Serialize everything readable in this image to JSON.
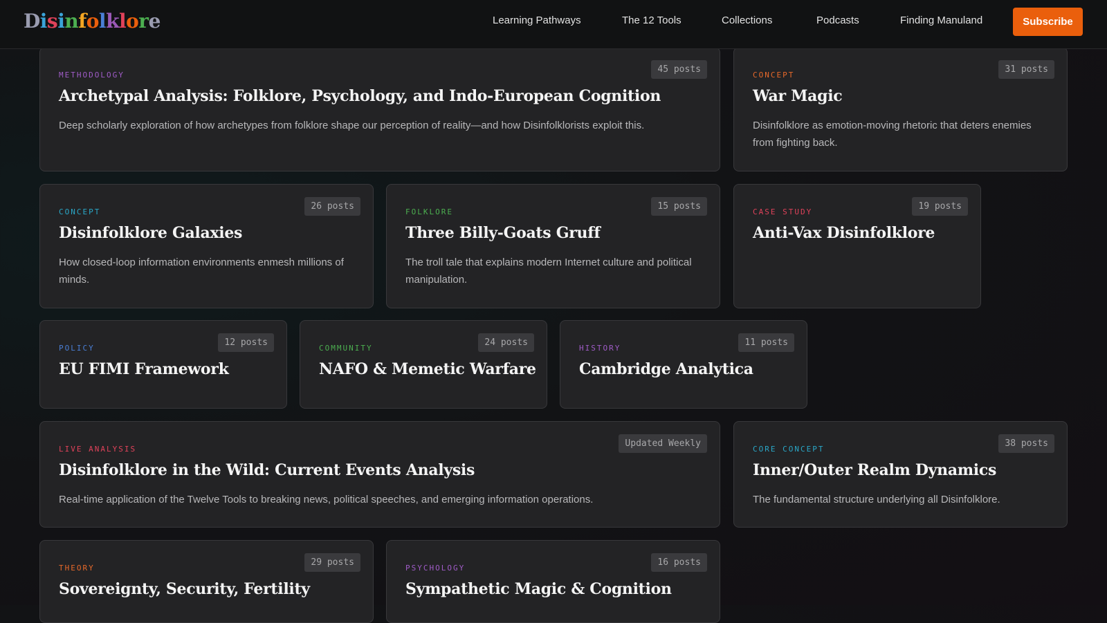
{
  "header": {
    "logo_letters": [
      {
        "ch": "D",
        "color": "#9a9cb0"
      },
      {
        "ch": "i",
        "color": "#3aa3d8"
      },
      {
        "ch": "s",
        "color": "#e0425a"
      },
      {
        "ch": "i",
        "color": "#3aa3d8"
      },
      {
        "ch": "n",
        "color": "#4caf50"
      },
      {
        "ch": "f",
        "color": "#f5a623"
      },
      {
        "ch": "o",
        "color": "#ea5f0c"
      },
      {
        "ch": "l",
        "color": "#4a7fd6"
      },
      {
        "ch": "k",
        "color": "#9b59b6"
      },
      {
        "ch": "l",
        "color": "#e0425a"
      },
      {
        "ch": "o",
        "color": "#ea5f0c"
      },
      {
        "ch": "r",
        "color": "#4caf50"
      },
      {
        "ch": "e",
        "color": "#9a9cb0"
      }
    ],
    "nav": [
      "Learning Pathways",
      "The 12 Tools",
      "Collections",
      "Podcasts",
      "Finding Manuland"
    ],
    "subscribe_label": "Subscribe",
    "accent": "#ea5f0c"
  },
  "cards": [
    {
      "category": "METHODOLOGY",
      "color": "#a05cc8",
      "badge": "45 posts",
      "title": "Archetypal Analysis: Folklore, Psychology, and Indo-European Cognition",
      "description": "Deep scholarly exploration of how archetypes from folklore shape our perception of reality—and how Disinfolklorists exploit this."
    },
    {
      "category": "CONCEPT",
      "color": "#e8692a",
      "badge": "31 posts",
      "title": "War Magic",
      "description": "Disinfolklore as emotion-moving rhetoric that deters enemies from fighting back."
    },
    {
      "category": "CONCEPT",
      "color": "#2aa8c8",
      "badge": "26 posts",
      "title": "Disinfolklore Galaxies",
      "description": "How closed-loop information environments enmesh millions of minds."
    },
    {
      "category": "FOLKLORE",
      "color": "#4caf50",
      "badge": "15 posts",
      "title": "Three Billy-Goats Gruff",
      "description": "The troll tale that explains modern Internet culture and political manipulation."
    },
    {
      "category": "CASE STUDY",
      "color": "#e0425a",
      "badge": "19 posts",
      "title": "Anti-Vax Disinfolklore",
      "description": ""
    },
    {
      "category": "POLICY",
      "color": "#4a7fd6",
      "badge": "12 posts",
      "title": "EU FIMI Framework",
      "description": ""
    },
    {
      "category": "COMMUNITY",
      "color": "#4caf50",
      "badge": "24 posts",
      "title": "NAFO & Memetic Warfare",
      "description": ""
    },
    {
      "category": "HISTORY",
      "color": "#a05cc8",
      "badge": "11 posts",
      "title": "Cambridge Analytica",
      "description": ""
    },
    {
      "category": "LIVE ANALYSIS",
      "color": "#e0425a",
      "badge": "Updated Weekly",
      "title": "Disinfolklore in the Wild: Current Events Analysis",
      "description": "Real-time application of the Twelve Tools to breaking news, political speeches, and emerging information operations."
    },
    {
      "category": "CORE CONCEPT",
      "color": "#2aa8c8",
      "badge": "38 posts",
      "title": "Inner/Outer Realm Dynamics",
      "description": "The fundamental structure underlying all Disinfolklore."
    },
    {
      "category": "THEORY",
      "color": "#e8692a",
      "badge": "29 posts",
      "title": "Sovereignty, Security, Fertility",
      "description": ""
    },
    {
      "category": "PSYCHOLOGY",
      "color": "#a05cc8",
      "badge": "16 posts",
      "title": "Sympathetic Magic & Cognition",
      "description": ""
    }
  ]
}
